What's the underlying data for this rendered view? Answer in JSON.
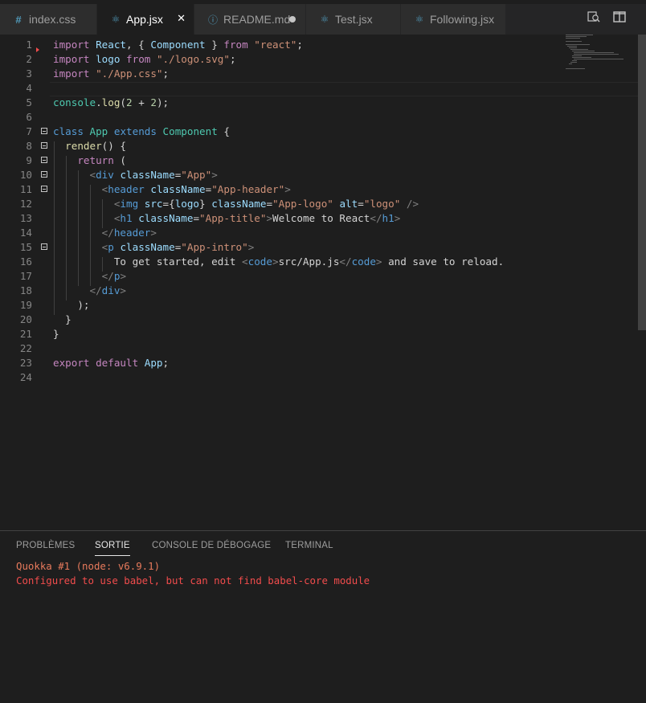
{
  "tabs": [
    {
      "label": "index.css",
      "icon": "hash-icon",
      "state": "inactive"
    },
    {
      "label": "App.jsx",
      "icon": "react-icon",
      "state": "active"
    },
    {
      "label": "README.md",
      "icon": "info-icon",
      "state": "modified"
    },
    {
      "label": "Test.jsx",
      "icon": "react-icon",
      "state": "inactive"
    },
    {
      "label": "Following.jsx",
      "icon": "react-icon",
      "state": "inactive"
    }
  ],
  "editor_actions": [
    "open-preview-icon",
    "split-editor-icon"
  ],
  "code": {
    "lines": [
      {
        "n": "1",
        "tokens": [
          [
            "kw",
            "import"
          ],
          [
            "txt",
            " "
          ],
          [
            "var",
            "React"
          ],
          [
            "txt",
            ", { "
          ],
          [
            "var",
            "Component"
          ],
          [
            "txt",
            " } "
          ],
          [
            "kw",
            "from"
          ],
          [
            "txt",
            " "
          ],
          [
            "str",
            "\"react\""
          ],
          [
            "txt",
            ";"
          ]
        ]
      },
      {
        "n": "2",
        "tokens": [
          [
            "kw",
            "import"
          ],
          [
            "txt",
            " "
          ],
          [
            "var",
            "logo"
          ],
          [
            "txt",
            " "
          ],
          [
            "kw",
            "from"
          ],
          [
            "txt",
            " "
          ],
          [
            "str",
            "\"./logo.svg\""
          ],
          [
            "txt",
            ";"
          ]
        ]
      },
      {
        "n": "3",
        "tokens": [
          [
            "kw",
            "import"
          ],
          [
            "txt",
            " "
          ],
          [
            "str",
            "\"./App.css\""
          ],
          [
            "txt",
            ";"
          ]
        ]
      },
      {
        "n": "4",
        "tokens": []
      },
      {
        "n": "5",
        "tokens": [
          [
            "cls",
            "console"
          ],
          [
            "txt",
            "."
          ],
          [
            "fn",
            "log"
          ],
          [
            "txt",
            "("
          ],
          [
            "num",
            "2"
          ],
          [
            "txt",
            " + "
          ],
          [
            "num",
            "2"
          ],
          [
            "txt",
            ");"
          ]
        ]
      },
      {
        "n": "6",
        "tokens": []
      },
      {
        "n": "7",
        "tokens": [
          [
            "kw2",
            "class"
          ],
          [
            "txt",
            " "
          ],
          [
            "cls",
            "App"
          ],
          [
            "txt",
            " "
          ],
          [
            "kw2",
            "extends"
          ],
          [
            "txt",
            " "
          ],
          [
            "cls",
            "Component"
          ],
          [
            "txt",
            " {"
          ]
        ]
      },
      {
        "n": "8",
        "tokens": [
          [
            "txt",
            "  "
          ],
          [
            "fn",
            "render"
          ],
          [
            "txt",
            "() {"
          ]
        ]
      },
      {
        "n": "9",
        "tokens": [
          [
            "txt",
            "    "
          ],
          [
            "kw",
            "return"
          ],
          [
            "txt",
            " ("
          ]
        ]
      },
      {
        "n": "10",
        "tokens": [
          [
            "txt",
            "      "
          ],
          [
            "pun",
            "<"
          ],
          [
            "tag",
            "div"
          ],
          [
            "txt",
            " "
          ],
          [
            "attr",
            "className"
          ],
          [
            "txt",
            "="
          ],
          [
            "str",
            "\"App\""
          ],
          [
            "pun",
            ">"
          ]
        ]
      },
      {
        "n": "11",
        "tokens": [
          [
            "txt",
            "        "
          ],
          [
            "pun",
            "<"
          ],
          [
            "tag",
            "header"
          ],
          [
            "txt",
            " "
          ],
          [
            "attr",
            "className"
          ],
          [
            "txt",
            "="
          ],
          [
            "str",
            "\"App-header\""
          ],
          [
            "pun",
            ">"
          ]
        ]
      },
      {
        "n": "12",
        "tokens": [
          [
            "txt",
            "          "
          ],
          [
            "pun",
            "<"
          ],
          [
            "tag",
            "img"
          ],
          [
            "txt",
            " "
          ],
          [
            "attr",
            "src"
          ],
          [
            "txt",
            "={"
          ],
          [
            "var",
            "logo"
          ],
          [
            "txt",
            "} "
          ],
          [
            "attr",
            "className"
          ],
          [
            "txt",
            "="
          ],
          [
            "str",
            "\"App-logo\""
          ],
          [
            "txt",
            " "
          ],
          [
            "attr",
            "alt"
          ],
          [
            "txt",
            "="
          ],
          [
            "str",
            "\"logo\""
          ],
          [
            "txt",
            " "
          ],
          [
            "pun",
            "/>"
          ]
        ]
      },
      {
        "n": "13",
        "tokens": [
          [
            "txt",
            "          "
          ],
          [
            "pun",
            "<"
          ],
          [
            "tag",
            "h1"
          ],
          [
            "txt",
            " "
          ],
          [
            "attr",
            "className"
          ],
          [
            "txt",
            "="
          ],
          [
            "str",
            "\"App-title\""
          ],
          [
            "pun",
            ">"
          ],
          [
            "txt",
            "Welcome to React"
          ],
          [
            "pun",
            "</"
          ],
          [
            "tag",
            "h1"
          ],
          [
            "pun",
            ">"
          ]
        ]
      },
      {
        "n": "14",
        "tokens": [
          [
            "txt",
            "        "
          ],
          [
            "pun",
            "</"
          ],
          [
            "tag",
            "header"
          ],
          [
            "pun",
            ">"
          ]
        ]
      },
      {
        "n": "15",
        "tokens": [
          [
            "txt",
            "        "
          ],
          [
            "pun",
            "<"
          ],
          [
            "tag",
            "p"
          ],
          [
            "txt",
            " "
          ],
          [
            "attr",
            "className"
          ],
          [
            "txt",
            "="
          ],
          [
            "str",
            "\"App-intro\""
          ],
          [
            "pun",
            ">"
          ]
        ]
      },
      {
        "n": "16",
        "tokens": [
          [
            "txt",
            "          To get started, edit "
          ],
          [
            "pun",
            "<"
          ],
          [
            "tag",
            "code"
          ],
          [
            "pun",
            ">"
          ],
          [
            "txt",
            "src/App.js"
          ],
          [
            "pun",
            "</"
          ],
          [
            "tag",
            "code"
          ],
          [
            "pun",
            ">"
          ],
          [
            "txt",
            " and save to reload."
          ]
        ]
      },
      {
        "n": "17",
        "tokens": [
          [
            "txt",
            "        "
          ],
          [
            "pun",
            "</"
          ],
          [
            "tag",
            "p"
          ],
          [
            "pun",
            ">"
          ]
        ]
      },
      {
        "n": "18",
        "tokens": [
          [
            "txt",
            "      "
          ],
          [
            "pun",
            "</"
          ],
          [
            "tag",
            "div"
          ],
          [
            "pun",
            ">"
          ]
        ]
      },
      {
        "n": "19",
        "tokens": [
          [
            "txt",
            "    );"
          ]
        ]
      },
      {
        "n": "20",
        "tokens": [
          [
            "txt",
            "  }"
          ]
        ]
      },
      {
        "n": "21",
        "tokens": [
          [
            "txt",
            "}"
          ]
        ]
      },
      {
        "n": "22",
        "tokens": []
      },
      {
        "n": "23",
        "tokens": [
          [
            "kw",
            "export"
          ],
          [
            "txt",
            " "
          ],
          [
            "kw",
            "default"
          ],
          [
            "txt",
            " "
          ],
          [
            "var",
            "App"
          ],
          [
            "txt",
            ";"
          ]
        ]
      },
      {
        "n": "24",
        "tokens": []
      }
    ],
    "fold_lines": [
      "7",
      "8",
      "9",
      "10",
      "11",
      "15"
    ]
  },
  "panel": {
    "tabs": [
      {
        "label": "PROBLÈMES",
        "active": false
      },
      {
        "label": "SORTIE",
        "active": true
      },
      {
        "label": "CONSOLE DE DÉBOGAGE",
        "active": false
      },
      {
        "label": "TERMINAL",
        "active": false
      }
    ],
    "output": [
      "Quokka #1 (node: v6.9.1)",
      "Configured to use babel, but can not find babel-core module"
    ]
  }
}
